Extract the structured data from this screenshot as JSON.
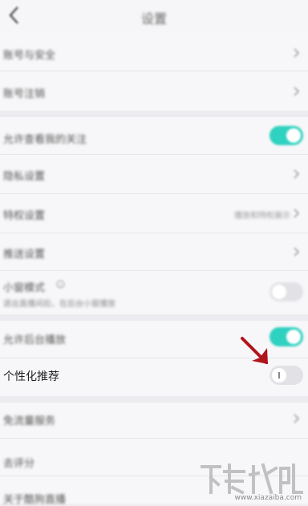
{
  "header": {
    "title": "设置"
  },
  "settings": {
    "account_security": "账号与安全",
    "account_cancel": "账号注销",
    "allow_view_following": "允许查看我的关注",
    "privacy_settings": "隐私设置",
    "permission_settings": "特权设置",
    "permission_value": "播放和特权展示",
    "push_settings": "推送设置",
    "teen_mode": "小窗模式",
    "teen_mode_desc": "退出直播间后，在后台小窗播放",
    "allow_background_play": "允许后台播放",
    "personalized_recommendation": "个性化推荐",
    "traffic_service": "免流量服务",
    "rate_us": "去评分",
    "about": "关于酷狗直播"
  },
  "toggles": {
    "allow_view_following": true,
    "teen_mode": false,
    "allow_background_play": true,
    "personalized_recommendation": false
  },
  "watermark": {
    "url": "www.xiazaiba.com"
  },
  "colors": {
    "accent": "#2fd1c0",
    "arrow": "#b0141c"
  },
  "icons": [
    "chevron-left-icon",
    "chevron-right-icon",
    "info-icon",
    "arrow-icon"
  ]
}
